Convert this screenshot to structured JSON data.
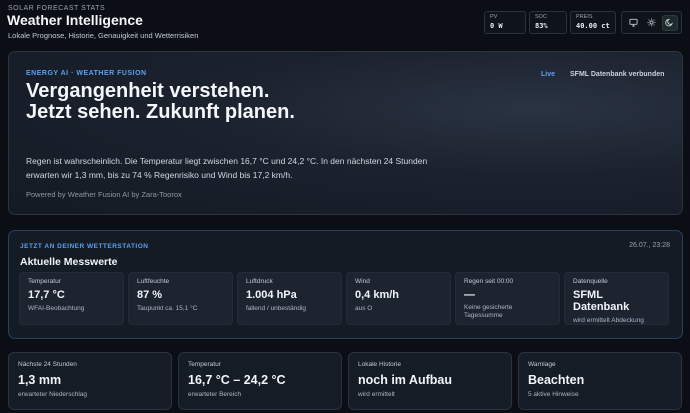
{
  "header": {
    "kicker": "SOLAR FORECAST STATS",
    "title": "Weather Intelligence",
    "subtitle": "Lokale Prognose, Historie, Genauigkeit und Wetterrisiken",
    "stats": [
      {
        "label": "PV",
        "value": "0 W"
      },
      {
        "label": "SOC",
        "value": "83%"
      },
      {
        "label": "PREIS",
        "value": "40.00 ct"
      }
    ],
    "theme_icons": [
      "monitor-icon",
      "sun-icon",
      "moon-icon"
    ],
    "active_theme": "moon"
  },
  "hero": {
    "kicker": "ENERGY AI · WEATHER FUSION",
    "title": "Vergangenheit verstehen. Jetzt sehen. Zukunft planen.",
    "description": "Regen ist wahrscheinlich. Die Temperatur liegt zwischen 16,7 °C und 24,2 °C. In den nächsten 24 Stunden erwarten wir 1,3 mm, bis zu 74 % Regenrisiko und Wind bis 17,2 km/h.",
    "powered": "Powered by Weather Fusion AI by Zara-Toorox",
    "live": "Live",
    "db_status": "SFML Datenbank verbunden"
  },
  "current": {
    "kicker": "JETZT AN DEINER WETTERSTATION",
    "title": "Aktuelle Messwerte",
    "timestamp": "26.07., 23:28",
    "tiles": [
      {
        "label": "Temperatur",
        "value": "17,7 °C",
        "sub": "WFAI-Beobachtung"
      },
      {
        "label": "Luftfeuchte",
        "value": "87 %",
        "sub": "Taupunkt ca. 15,1 °C"
      },
      {
        "label": "Luftdruck",
        "value": "1.004 hPa",
        "sub": "fallend / unbeständig"
      },
      {
        "label": "Wind",
        "value": "0,4 km/h",
        "sub": "aus O"
      },
      {
        "label": "Regen seit 00:00",
        "value": "—",
        "sub": "Keine gesicherte Tagessumme"
      },
      {
        "label": "Datenquelle",
        "value": "SFML Datenbank",
        "sub": "wird ermittelt Abdeckung"
      }
    ]
  },
  "cards": [
    {
      "label": "Nächste 24 Stunden",
      "value": "1,3 mm",
      "sub": "erwarteter Niederschlag"
    },
    {
      "label": "Temperatur",
      "value": "16,7 °C – 24,2 °C",
      "sub": "erwarteter Bereich"
    },
    {
      "label": "Lokale Historie",
      "value": "noch im Aufbau",
      "sub": "wird ermittelt"
    },
    {
      "label": "Warnlage",
      "value": "Beachten",
      "sub": "5 aktive Hinweise"
    }
  ]
}
